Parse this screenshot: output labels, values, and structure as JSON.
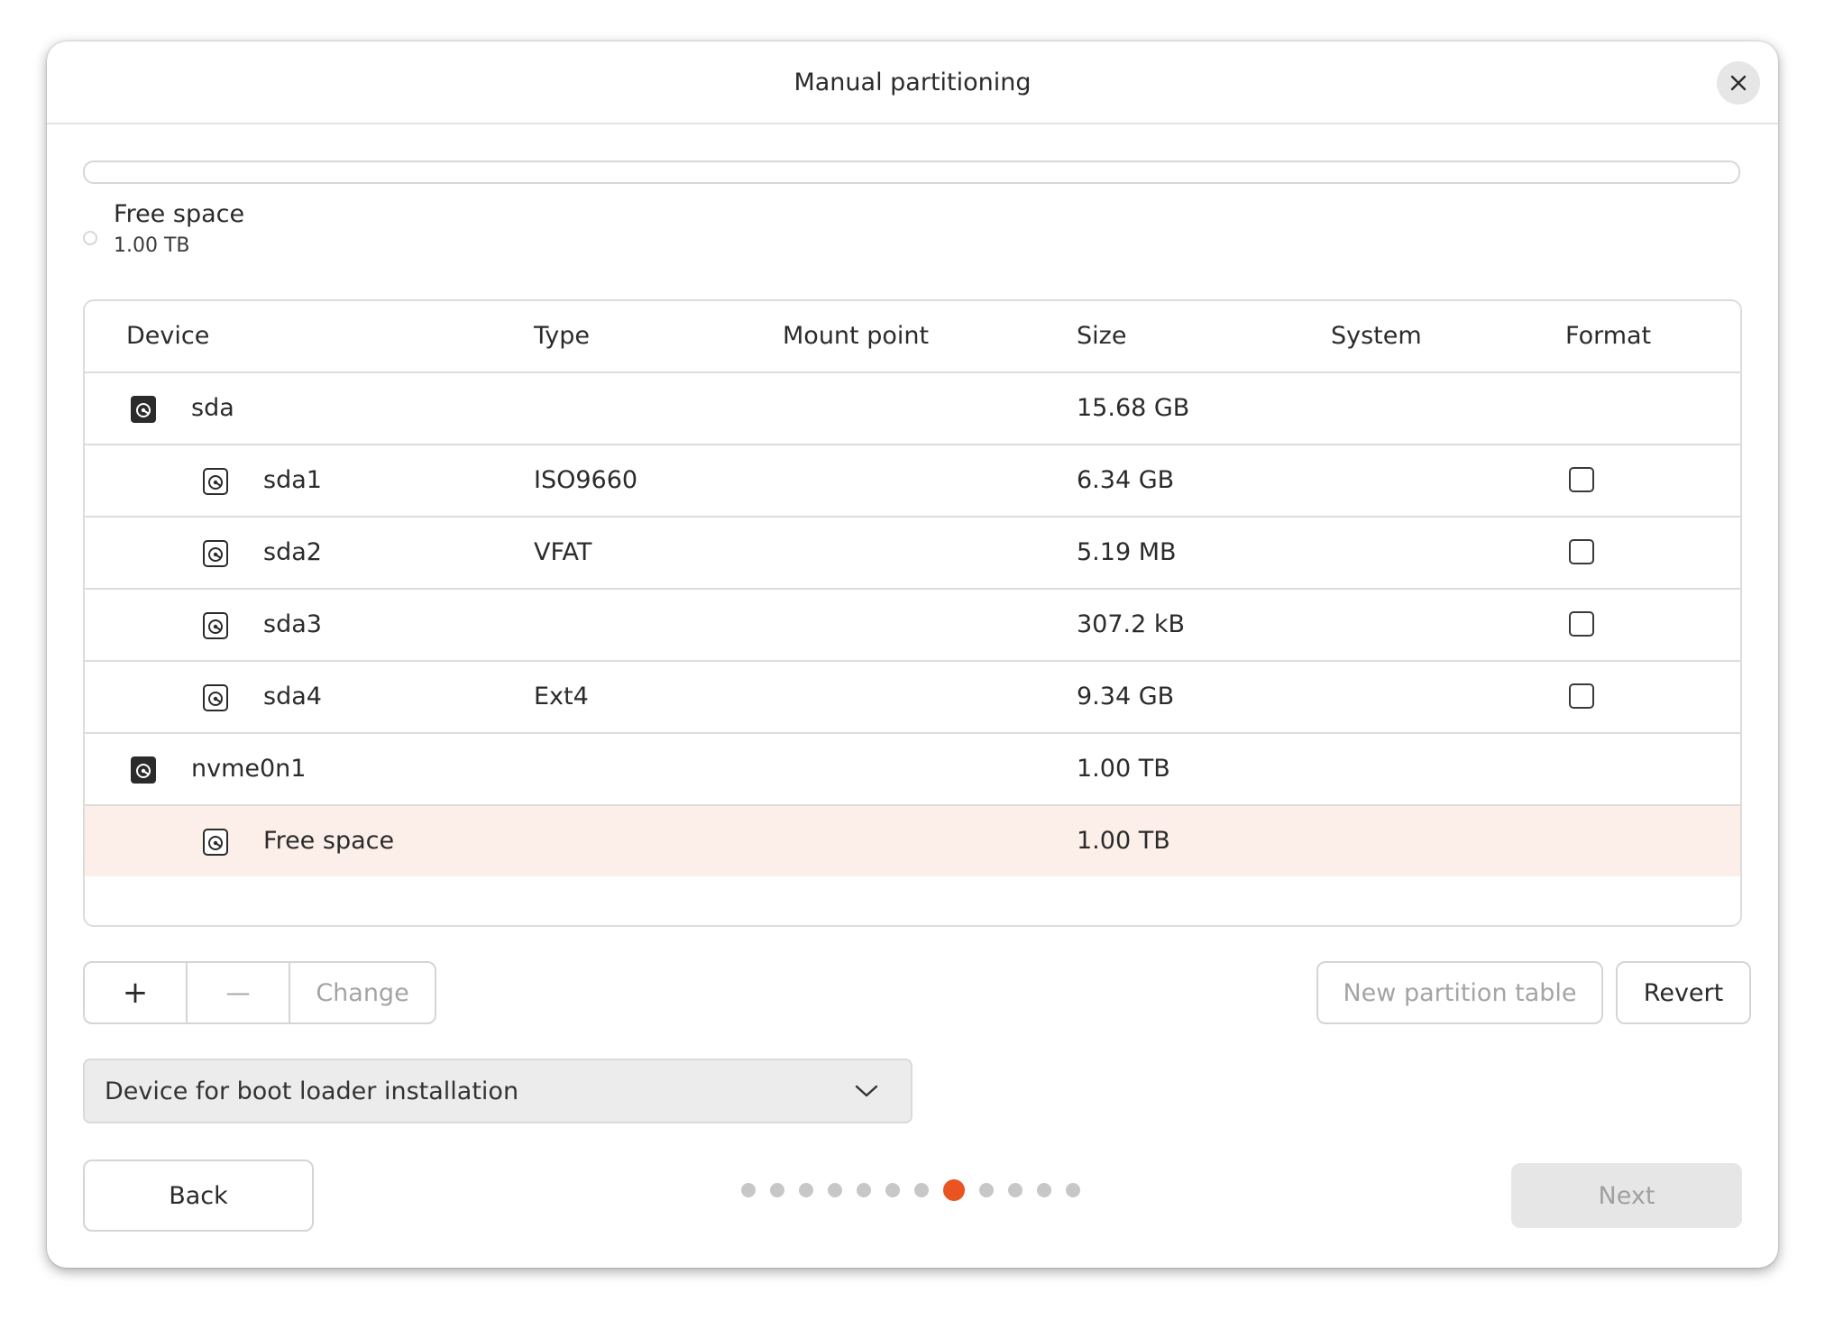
{
  "window": {
    "title": "Manual partitioning"
  },
  "usage": {
    "legend": [
      {
        "name": "Free space",
        "size": "1.00 TB"
      }
    ]
  },
  "table": {
    "columns": [
      "Device",
      "Type",
      "Mount point",
      "Size",
      "System",
      "Format"
    ],
    "rows": [
      {
        "device": "sda",
        "type": "",
        "mount": "",
        "size": "15.68 GB",
        "system": "",
        "format_checkbox": false,
        "is_disk": true,
        "selected": false
      },
      {
        "device": "sda1",
        "type": "ISO9660",
        "mount": "",
        "size": "6.34 GB",
        "system": "",
        "format_checkbox": true,
        "is_disk": false,
        "selected": false
      },
      {
        "device": "sda2",
        "type": "VFAT",
        "mount": "",
        "size": "5.19 MB",
        "system": "",
        "format_checkbox": true,
        "is_disk": false,
        "selected": false
      },
      {
        "device": "sda3",
        "type": "",
        "mount": "",
        "size": "307.2 kB",
        "system": "",
        "format_checkbox": true,
        "is_disk": false,
        "selected": false
      },
      {
        "device": "sda4",
        "type": "Ext4",
        "mount": "",
        "size": "9.34 GB",
        "system": "",
        "format_checkbox": true,
        "is_disk": false,
        "selected": false
      },
      {
        "device": "nvme0n1",
        "type": "",
        "mount": "",
        "size": "1.00 TB",
        "system": "",
        "format_checkbox": false,
        "is_disk": true,
        "selected": false
      },
      {
        "device": "Free space",
        "type": "",
        "mount": "",
        "size": "1.00 TB",
        "system": "",
        "format_checkbox": false,
        "is_disk": false,
        "selected": true
      }
    ]
  },
  "toolbar": {
    "add_label": "+",
    "remove_label": "—",
    "change_label": "Change",
    "new_table_label": "New partition table",
    "revert_label": "Revert"
  },
  "bootloader": {
    "label": "Device for boot loader installation"
  },
  "nav": {
    "back_label": "Back",
    "next_label": "Next",
    "step_count": 12,
    "current_step": 8
  },
  "colors": {
    "accent": "#e95420",
    "selected_row": "#fcefea"
  }
}
